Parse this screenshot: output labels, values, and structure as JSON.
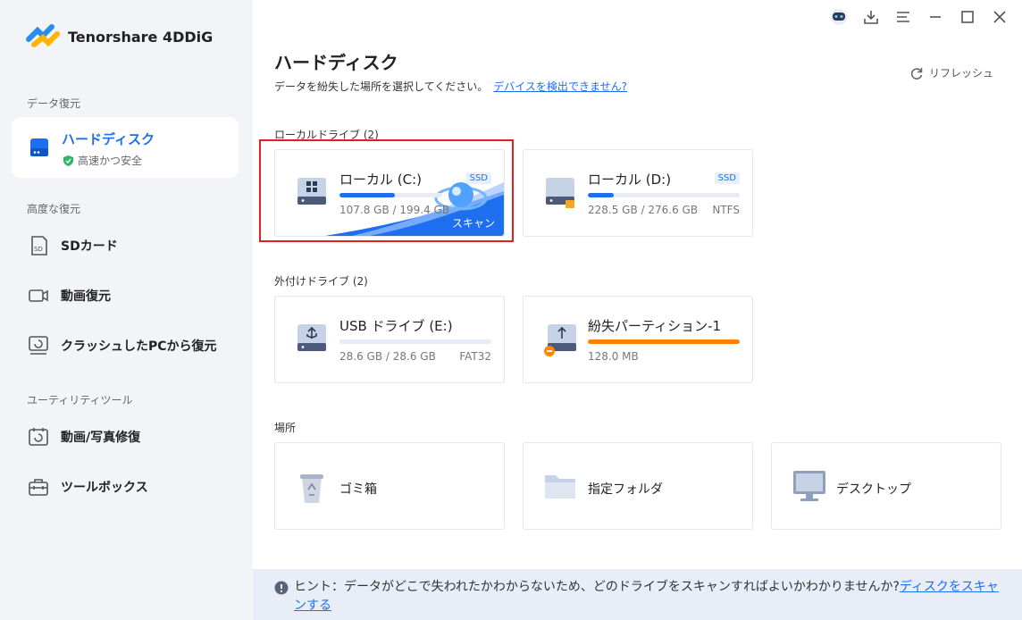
{
  "app": {
    "name": "Tenorshare 4DDiG"
  },
  "sidebar": {
    "sections": [
      "データ復元",
      "高度な復元",
      "ユーティリティツール"
    ],
    "active": {
      "label": "ハードディスク",
      "sub": "高速かつ安全"
    },
    "items": [
      {
        "label": "SDカード",
        "icon": "sd-card-icon"
      },
      {
        "label": "動画復元",
        "icon": "video-camera-icon"
      },
      {
        "label": "クラッシュしたPCから復元",
        "icon": "crashed-pc-icon"
      },
      {
        "label": "動画/写真修復",
        "icon": "photo-repair-icon"
      },
      {
        "label": "ツールボックス",
        "icon": "toolbox-icon"
      }
    ]
  },
  "main": {
    "title": "ハードディスク",
    "subtitle": "データを紛失した場所を選択してください。",
    "subtitle_link": "デバイスを検出できません?",
    "refresh": "リフレッシュ"
  },
  "groups": {
    "local": "ローカルドライブ (2)",
    "external": "外付けドライブ (2)",
    "location": "場所"
  },
  "drives": [
    {
      "name": "ローカル (C:)",
      "badge": "SSD",
      "size": "107.8 GB / 199.4 GB",
      "fs": "",
      "used": 0.54,
      "scan": "スキャン"
    },
    {
      "name": "ローカル (D:)",
      "badge": "SSD",
      "size": "228.5 GB / 276.6 GB",
      "fs": "NTFS",
      "used": 0.17
    },
    {
      "name": "USB ドライブ (E:)",
      "badge": "",
      "size": "28.6 GB / 28.6 GB",
      "fs": "FAT32",
      "used": 0.0
    },
    {
      "name": "紛失パーティション-1",
      "badge": "",
      "size": "128.0 MB",
      "fs": "",
      "used": 1.0
    }
  ],
  "locations": [
    {
      "label": "ゴミ箱",
      "icon": "recycle-bin-icon"
    },
    {
      "label": "指定フォルダ",
      "icon": "folder-icon"
    },
    {
      "label": "デスクトップ",
      "icon": "desktop-icon"
    }
  ],
  "hint": {
    "text": "ヒント：データがどこで失われたかわからないため、どのドライブをスキャンすればよいかわかりませんか?",
    "link": "ディスクをスキャンする"
  },
  "colors": {
    "accent": "#1e6ff0",
    "lost": "#ff7f00",
    "highlight": "#e02020"
  }
}
